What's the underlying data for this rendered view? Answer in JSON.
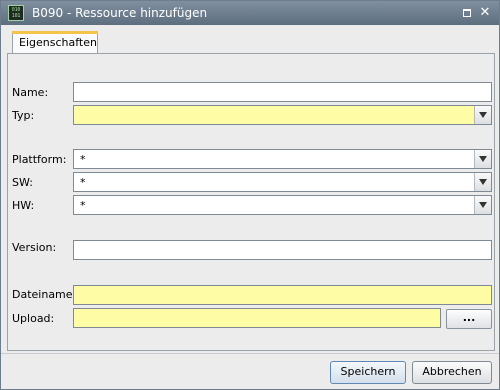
{
  "window": {
    "title": "B090 - Ressource hinzufügen",
    "app_icon_text": "010 101"
  },
  "tabs": [
    {
      "label": "Eigenschaften",
      "selected": true
    }
  ],
  "form": {
    "name": {
      "label": "Name:",
      "value": ""
    },
    "typ": {
      "label": "Typ:",
      "value": "",
      "required": true
    },
    "plattform": {
      "label": "Plattform:",
      "value": "*"
    },
    "sw": {
      "label": "SW:",
      "value": "*"
    },
    "hw": {
      "label": "HW:",
      "value": "*"
    },
    "version": {
      "label": "Version:",
      "value": ""
    },
    "dateiname": {
      "label": "Dateiname:",
      "value": "",
      "required": true
    },
    "upload": {
      "label": "Upload:",
      "value": "",
      "required": true,
      "browse_label": "..."
    }
  },
  "buttons": {
    "save": "Speichern",
    "cancel": "Abbrechen"
  },
  "colors": {
    "required_field": "#fffca6",
    "titlebar": "#6e7f8f",
    "tab_accent": "#f3c34a"
  }
}
